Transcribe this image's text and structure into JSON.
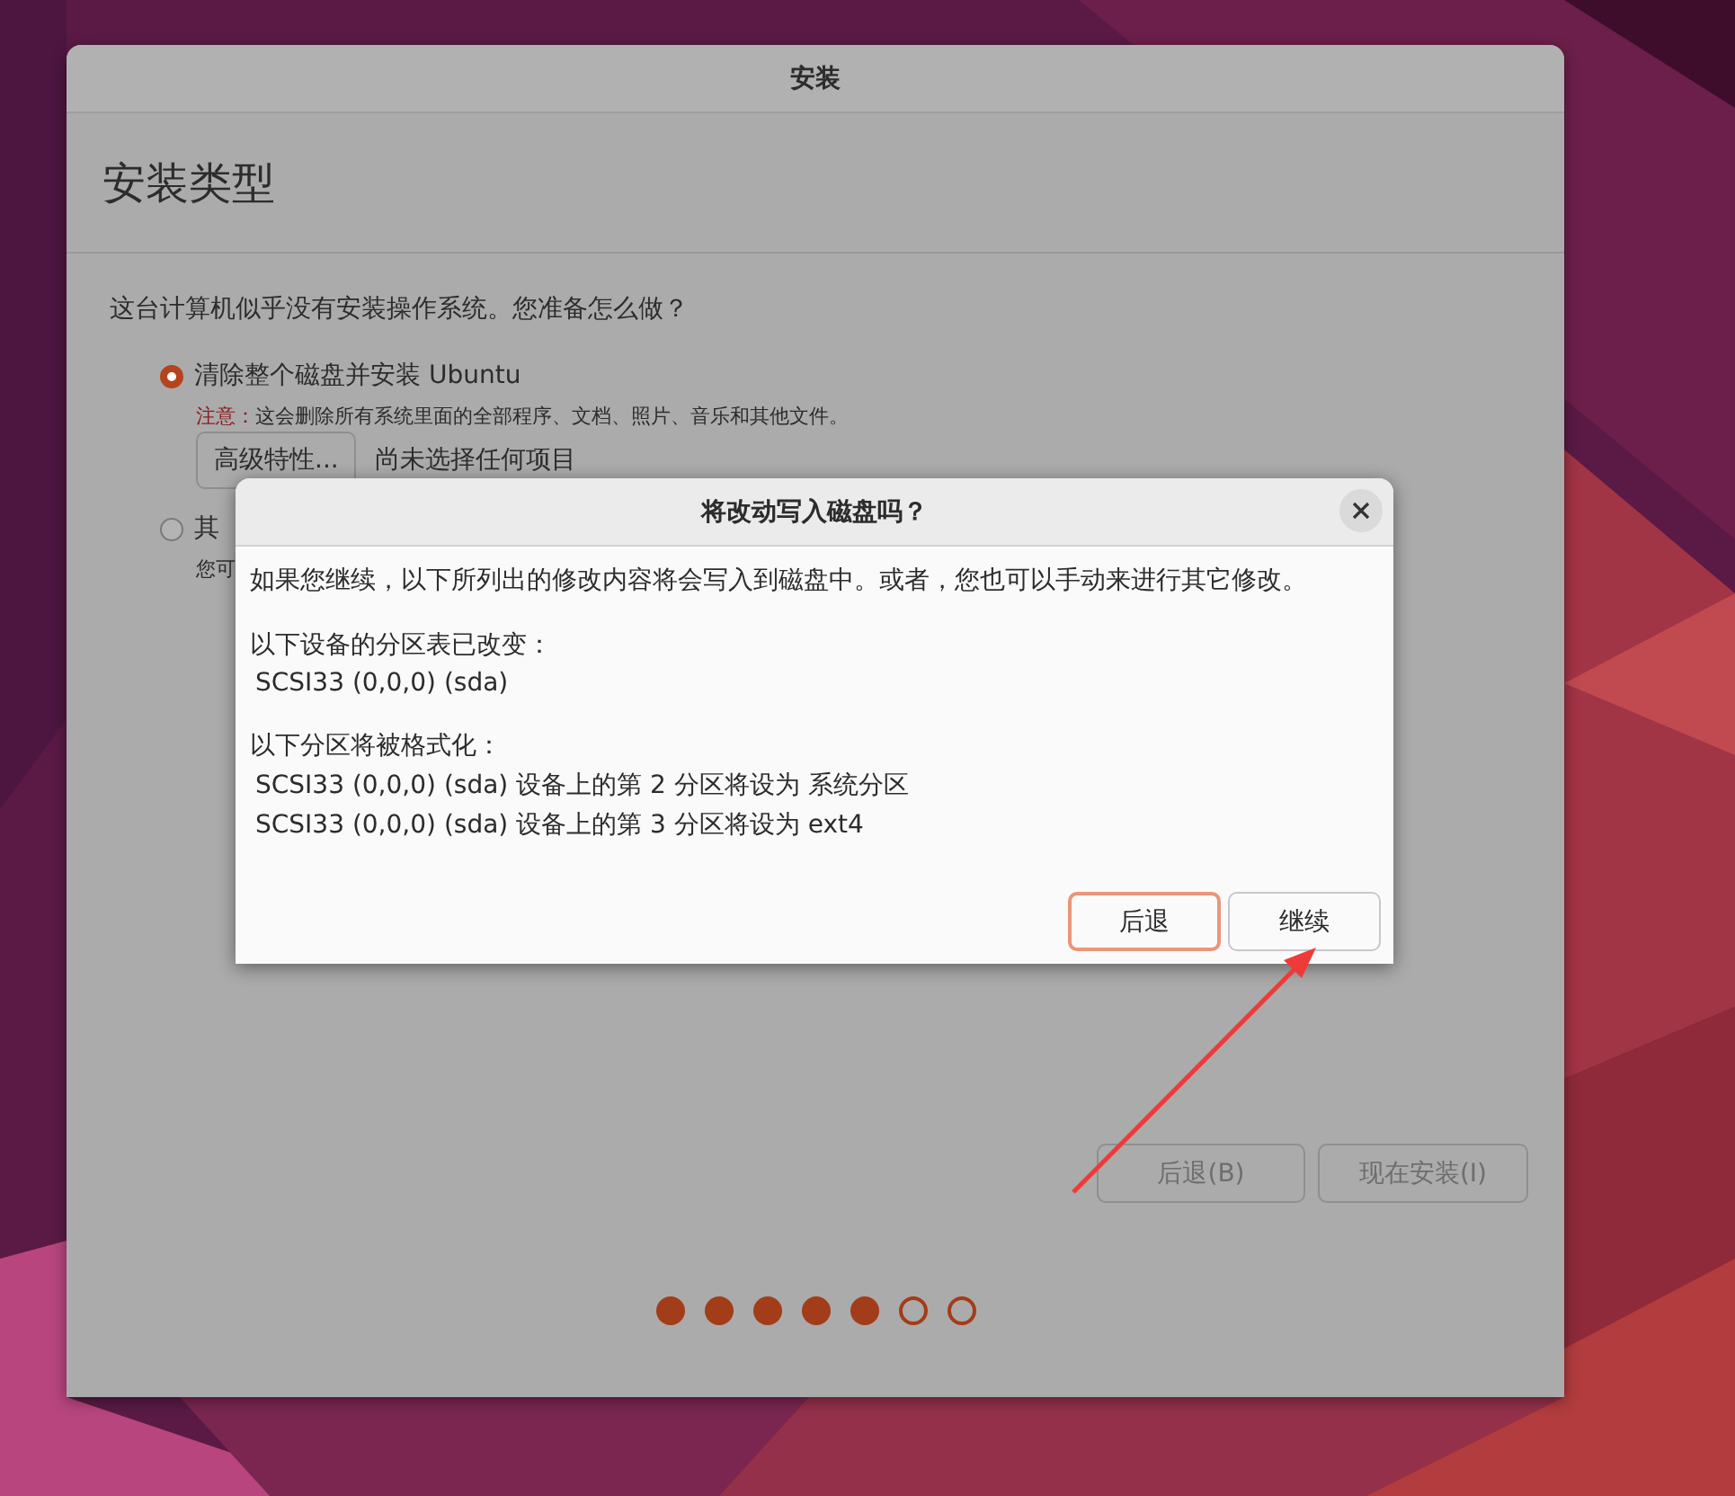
{
  "window": {
    "title": "安装",
    "heading": "安装类型",
    "question": "这台计算机似乎没有安装操作系统。您准备怎么做？",
    "options": [
      {
        "label": "清除整个磁盘并安装 Ubuntu",
        "selected": true,
        "note_label": "注意：",
        "note": "这会删除所有系统里面的全部程序、文档、照片、音乐和其他文件。",
        "advanced_button": "高级特性...",
        "advanced_status": "尚未选择任何项目"
      },
      {
        "label": "其",
        "selected": false,
        "note": "您可"
      }
    ],
    "buttons": [
      {
        "label": "后退(B)",
        "disabled": true
      },
      {
        "label": "现在安装(I)",
        "disabled": true
      }
    ],
    "steps": [
      {
        "done": true
      },
      {
        "done": true
      },
      {
        "done": true
      },
      {
        "done": true
      },
      {
        "done": true
      },
      {
        "done": false
      },
      {
        "done": false
      }
    ]
  },
  "dialog": {
    "title": "将改动写入磁盘吗？",
    "intro": "如果您继续，以下所列出的修改内容将会写入到磁盘中。或者，您也可以手动来进行其它修改。",
    "sections": [
      {
        "heading": "以下设备的分区表已改变：",
        "items": [
          "SCSI33 (0,0,0) (sda)"
        ]
      },
      {
        "heading": "以下分区将被格式化：",
        "items": [
          "SCSI33 (0,0,0) (sda) 设备上的第 2 分区将设为 系统分区",
          "SCSI33 (0,0,0) (sda) 设备上的第 3 分区将设为 ext4"
        ]
      }
    ],
    "buttons": [
      {
        "label": "后退",
        "kind": "suggested"
      },
      {
        "label": "继续",
        "kind": "normal"
      }
    ]
  }
}
